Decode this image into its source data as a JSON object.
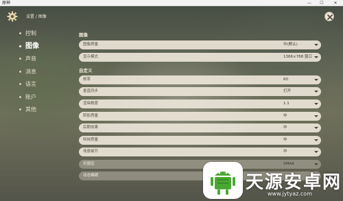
{
  "window": {
    "title": "原神",
    "minimize": "—",
    "maximize": "☐",
    "close": "✕"
  },
  "header": {
    "breadcrumb": "设置 / 图像"
  },
  "menu": {
    "items": [
      {
        "label": "控制"
      },
      {
        "label": "图像"
      },
      {
        "label": "声音"
      },
      {
        "label": "消息"
      },
      {
        "label": "语言"
      },
      {
        "label": "账户"
      },
      {
        "label": "其他"
      }
    ],
    "active": "图像"
  },
  "sections": {
    "image": "图像",
    "custom": "自定义"
  },
  "settings": {
    "image": [
      {
        "label": "图像质量",
        "value": "中(默认)"
      },
      {
        "label": "显示模式",
        "value": "1366×768 窗口"
      }
    ],
    "custom": [
      {
        "label": "帧率",
        "value": "60"
      },
      {
        "label": "垂直同步",
        "value": "打开"
      },
      {
        "label": "渲染精度",
        "value": "1.1"
      },
      {
        "label": "阴影质量",
        "value": "中"
      },
      {
        "label": "后期效果",
        "value": "中"
      },
      {
        "label": "特效质量",
        "value": "中"
      },
      {
        "label": "场景细节",
        "value": "中"
      },
      {
        "label": "抗锯齿",
        "value": "SMAA"
      },
      {
        "label": "动态模糊",
        "value": ""
      }
    ]
  },
  "watermark": {
    "brand": "天源安卓网",
    "url": "www.jytyaz.com"
  }
}
